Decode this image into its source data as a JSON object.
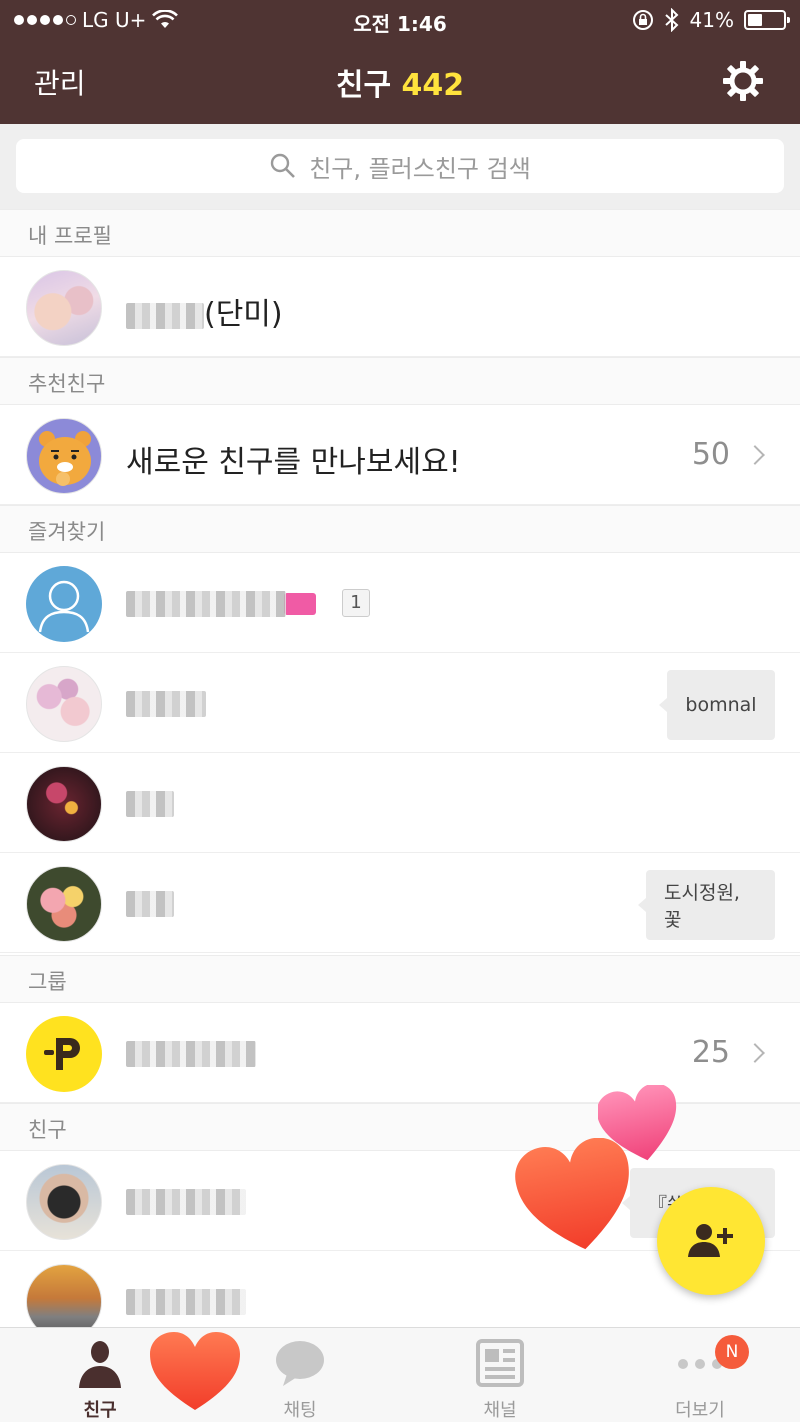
{
  "status_bar": {
    "carrier": "LG U+",
    "time": "오전 1:46",
    "battery": "41%"
  },
  "header": {
    "manage_label": "관리",
    "title": "친구",
    "friend_count": "442"
  },
  "search": {
    "placeholder": "친구, 플러스친구 검색"
  },
  "sections": {
    "my_profile": "내 프로필",
    "recommended": "추천친구",
    "favorites": "즐겨찾기",
    "groups": "그룹",
    "friends": "친구"
  },
  "my_profile": {
    "name_suffix": "(단미)"
  },
  "recommended": {
    "label": "새로운 친구를 만나보세요!",
    "count": "50"
  },
  "favorites": {
    "items": [
      {
        "badge": "1"
      },
      {
        "status": "bomnal"
      },
      {
        "status": ""
      },
      {
        "status": "도시정원,꽃"
      }
    ]
  },
  "groups": {
    "count": "25"
  },
  "friends": {
    "items": [
      {
        "status": "『쏭이"
      },
      {
        "status": ""
      }
    ]
  },
  "tabbar": {
    "friends": "친구",
    "chat": "채팅",
    "channel": "채널",
    "more": "더보기",
    "more_badge": "N"
  },
  "colors": {
    "header_bg": "#4f3433",
    "accent_yellow": "#ffe33d",
    "fab_yellow": "#ffe633",
    "badge_red": "#f55b3b"
  }
}
